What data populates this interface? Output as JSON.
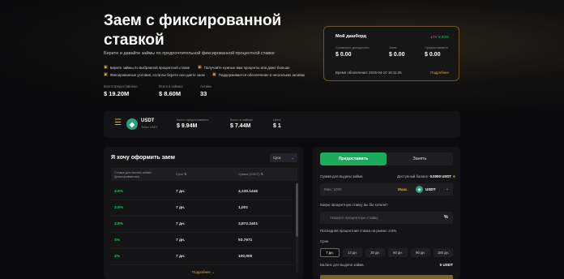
{
  "hero": {
    "title": "Заем с фиксированной ставкой",
    "subtitle": "Берите и давайте займы по предпочтительной фиксированной процентной ставке",
    "features": [
      "Берите займы по выбранной процентной ставке",
      "Получайте нужные вам проценты или даже больше",
      "Фиксированные условия, если вы берете или даете заем",
      "Поддерживается обеспечение в нескольких активах"
    ],
    "stats": [
      {
        "label": "Всего предоставлено",
        "value": "$ 19.20M"
      },
      {
        "label": "Всего в займах",
        "value": "$ 8.60M"
      },
      {
        "label": "Активы",
        "value": "33"
      }
    ]
  },
  "dashboard": {
    "title": "Мой дашборд",
    "ltv_label": "LTV",
    "ltv_value": "0.00%",
    "items": [
      {
        "label": "Суммарно доходность",
        "value": "$ 0.00"
      },
      {
        "label": "Заем",
        "value": "$ 0.00"
      },
      {
        "label": "Предоставлено",
        "value": "$ 0.00"
      }
    ],
    "update_time": "Время обновления: 2025-04-10 16:11:25",
    "more_label": "Подробнее"
  },
  "coin_bar": {
    "name": "USDT",
    "subtitle": "Tether USDT",
    "stats": [
      {
        "label": "Всего предоставлено",
        "value": "$ 9.94M"
      },
      {
        "label": "Всего в займах",
        "value": "$ 7.44M"
      },
      {
        "label": "Цена",
        "value": "$ 1"
      }
    ]
  },
  "borrow_panel": {
    "title": "Я хочу оформить заем",
    "term_select": "Срок",
    "columns": [
      "Ставка для взятия займа (фиксированная)",
      "Срок",
      "Сумма (USDT)"
    ],
    "rows": [
      {
        "rate": "3.6%",
        "term": "7 дн.",
        "amount": "4,130.1446"
      },
      {
        "rate": "3.6%",
        "term": "7 дн.",
        "amount": "1,001"
      },
      {
        "rate": "3.8%",
        "term": "7 дн.",
        "amount": "3,872.2401"
      },
      {
        "rate": "4%",
        "term": "7 дн.",
        "amount": "93.7671"
      },
      {
        "rate": "4%",
        "term": "7 дн.",
        "amount": "100,000"
      }
    ],
    "more_label": "Подробнее"
  },
  "lend_panel": {
    "tab_lend": "Предоставить",
    "tab_borrow": "Занять",
    "amount_label": "Сумма для выдачи займа",
    "available_label": "Доступный баланс:",
    "available_value": "0.0000 USDT",
    "amount_placeholder": "Мин. 1000",
    "max_label": "Макс.",
    "currency": "USDT",
    "rate_label": "Какую процентную ставку вы бы хотели?",
    "rate_placeholder": "Укажите процентную ставку",
    "rate_unit": "%",
    "market_rate": "Последняя процентная ставка на рынке: 3.6%",
    "term_label": "Срок",
    "terms": [
      "7 дн.",
      "14 дн.",
      "30 дн.",
      "60 дн.",
      "90 дн.",
      "180 дн."
    ],
    "selected_term": "7 дн.",
    "balance_label": "Баланс для выдачи займа",
    "balance_value": "0 USDT"
  },
  "colors": {
    "accent_gold": "#d9a94a",
    "accent_green": "#1aab5c",
    "rate_green": "#22c55e",
    "background": "#0b0b0d",
    "panel": "#141416"
  },
  "icons": {
    "coin": "tether-icon",
    "menu": "menu-icon",
    "chevron": "chevron-down-icon"
  }
}
